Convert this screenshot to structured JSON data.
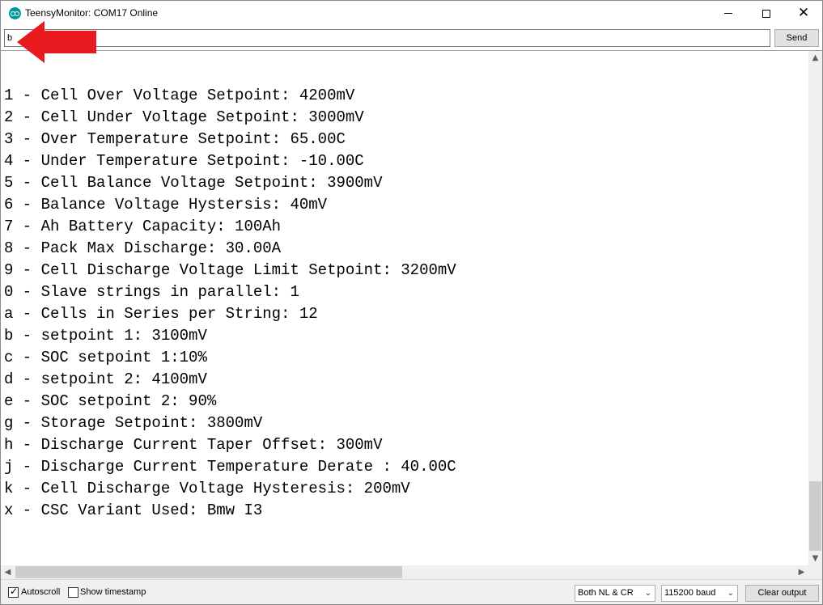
{
  "window": {
    "title": "TeensyMonitor: COM17 Online",
    "icon": "arduino-icon"
  },
  "input": {
    "value": "b",
    "send_label": "Send"
  },
  "annotation": {
    "arrow_color": "#e8191f"
  },
  "output": {
    "lines": [
      "1 - Cell Over Voltage Setpoint: 4200mV",
      "2 - Cell Under Voltage Setpoint: 3000mV",
      "3 - Over Temperature Setpoint: 65.00C",
      "4 - Under Temperature Setpoint: -10.00C",
      "5 - Cell Balance Voltage Setpoint: 3900mV",
      "6 - Balance Voltage Hystersis: 40mV",
      "7 - Ah Battery Capacity: 100Ah",
      "8 - Pack Max Discharge: 30.00A",
      "9 - Cell Discharge Voltage Limit Setpoint: 3200mV",
      "0 - Slave strings in parallel: 1",
      "a - Cells in Series per String: 12",
      "b - setpoint 1: 3100mV",
      "c - SOC setpoint 1:10%",
      "d - setpoint 2: 4100mV",
      "e - SOC setpoint 2: 90%",
      "g - Storage Setpoint: 3800mV",
      "h - Discharge Current Taper Offset: 300mV",
      "j - Discharge Current Temperature Derate : 40.00C",
      "k - Cell Discharge Voltage Hysteresis: 200mV",
      "x - CSC Variant Used: Bmw I3"
    ]
  },
  "bottom": {
    "autoscroll_label": "Autoscroll",
    "autoscroll_checked": true,
    "timestamp_label": "Show timestamp",
    "timestamp_checked": false,
    "line_ending": "Both NL & CR",
    "baud": "115200 baud",
    "clear_label": "Clear output"
  }
}
